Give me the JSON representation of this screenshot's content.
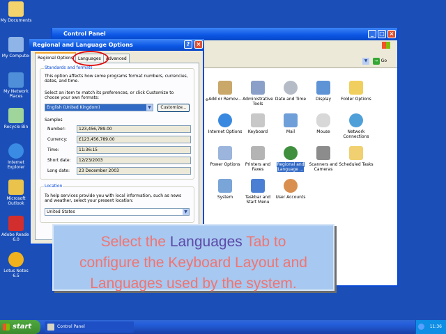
{
  "desktop": {
    "icons": [
      {
        "label": "My Documents",
        "color": "#f3d36b"
      },
      {
        "label": "My Computer",
        "color": "#8fb4e8"
      },
      {
        "label": "My Network Places",
        "color": "#4f8fd9"
      },
      {
        "label": "Recycle Bin",
        "color": "#9fd59a"
      },
      {
        "label": "Internet Explorer",
        "color": "#3a8be3"
      },
      {
        "label": "Microsoft Outlook",
        "color": "#e9c34b"
      },
      {
        "label": "Adobe Reader 6.0",
        "color": "#d22e2e"
      },
      {
        "label": "Lotus Notes 6.5",
        "color": "#f2b21d"
      }
    ]
  },
  "control_panel": {
    "title": "Control Panel",
    "go_label": "Go",
    "items": [
      {
        "label": "Add or Remov...",
        "color": "#c9a86a"
      },
      {
        "label": "Administrative Tools",
        "color": "#8aa0c8"
      },
      {
        "label": "Date and Time",
        "color": "#b5bcc8"
      },
      {
        "label": "Display",
        "color": "#5e93d6"
      },
      {
        "label": "Folder Options",
        "color": "#f0cf5e"
      },
      {
        "label": "Internet Options",
        "color": "#3a89e0"
      },
      {
        "label": "Keyboard",
        "color": "#c8c8c8"
      },
      {
        "label": "Mail",
        "color": "#6f9fd8"
      },
      {
        "label": "Mouse",
        "color": "#d8d8d8"
      },
      {
        "label": "Network Connections",
        "color": "#4fa0d8"
      },
      {
        "label": "Power Options",
        "color": "#9bb5dc"
      },
      {
        "label": "Printers and Faxes",
        "color": "#b4b4b4"
      },
      {
        "label": "Regional and Language ...",
        "color": "#3f8f3f"
      },
      {
        "label": "Scanners and Cameras",
        "color": "#8c8c8c"
      },
      {
        "label": "Scheduled Tasks",
        "color": "#f0d070"
      },
      {
        "label": "System",
        "color": "#7aa5d8"
      },
      {
        "label": "Taskbar and Start Menu",
        "color": "#4b7fd3"
      },
      {
        "label": "User Accounts",
        "color": "#d98f4f"
      }
    ],
    "edge_label": "e"
  },
  "dialog": {
    "title": "Regional and Language Options",
    "tabs": [
      "Regional Options",
      "Languages",
      "Advanced"
    ],
    "standards": {
      "legend": "Standards and formats",
      "desc": "This option affects how some programs format numbers, currencies, dates, and time.",
      "select_prompt": "Select an item to match its preferences, or click Customize to choose your own formats:",
      "locale_value": "English (United Kingdom)",
      "customize_label": "Customize..."
    },
    "samples": {
      "heading": "Samples",
      "rows": [
        {
          "label": "Number:",
          "value": "123,456,789.00"
        },
        {
          "label": "Currency:",
          "value": "£123,456,789.00"
        },
        {
          "label": "Time:",
          "value": "11:36:15"
        },
        {
          "label": "Short date:",
          "value": "12/23/2003"
        },
        {
          "label": "Long date:",
          "value": "23 December 2003"
        }
      ]
    },
    "location": {
      "legend": "Location",
      "desc": "To help services provide you with local information, such as news and weather, select your present location:",
      "value": "United States"
    }
  },
  "callout": {
    "line1_pre": "Select the ",
    "keyword": "Languages",
    "line1_post": " Tab to",
    "line2": "configure the Keyboard Layout and",
    "line3": "Languages used by the system."
  },
  "taskbar": {
    "start_label": "start",
    "task_label": "Control Panel",
    "clock": "11:36"
  }
}
